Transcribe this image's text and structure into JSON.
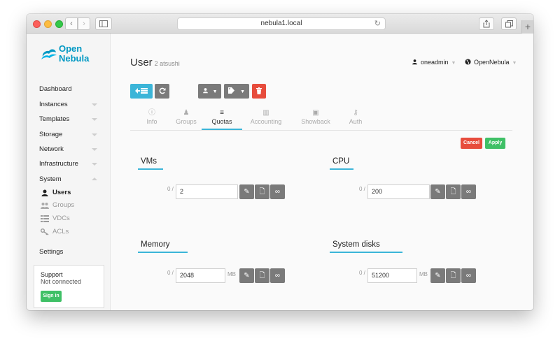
{
  "browser": {
    "url": "nebula1.local",
    "reload_glyph": "↻",
    "back_glyph": "‹",
    "forward_glyph": "›",
    "newtab_glyph": "+"
  },
  "logo": {
    "line1": "Open",
    "line2": "Nebula"
  },
  "sidebar": {
    "items": [
      {
        "label": "Dashboard"
      },
      {
        "label": "Instances"
      },
      {
        "label": "Templates"
      },
      {
        "label": "Storage"
      },
      {
        "label": "Network"
      },
      {
        "label": "Infrastructure"
      },
      {
        "label": "System"
      }
    ],
    "system_children": [
      {
        "label": "Users",
        "icon": "user-icon"
      },
      {
        "label": "Groups",
        "icon": "users-icon"
      },
      {
        "label": "VDCs",
        "icon": "list-icon"
      },
      {
        "label": "ACLs",
        "icon": "key-icon"
      }
    ],
    "settings": "Settings",
    "support": {
      "title": "Support",
      "status": "Not connected",
      "signin": "Sign in"
    }
  },
  "header": {
    "title": "User",
    "subtitle": "2 atsushi",
    "user": "oneadmin",
    "zone": "OpenNebula"
  },
  "tabs": [
    {
      "label": "Info",
      "icon": "info-icon",
      "glyph": "ⓘ"
    },
    {
      "label": "Groups",
      "icon": "users-icon",
      "glyph": "♟"
    },
    {
      "label": "Quotas",
      "icon": "align-icon",
      "glyph": "≡"
    },
    {
      "label": "Accounting",
      "icon": "bar-chart-icon",
      "glyph": "▥"
    },
    {
      "label": "Showback",
      "icon": "money-icon",
      "glyph": "▣"
    },
    {
      "label": "Auth",
      "icon": "key-icon",
      "glyph": "⚷"
    }
  ],
  "actions": {
    "cancel": "Cancel",
    "apply": "Apply"
  },
  "quotas": [
    {
      "title": "VMs",
      "used": "0 /",
      "value": "2",
      "unit": ""
    },
    {
      "title": "CPU",
      "used": "0 /",
      "value": "200",
      "unit": ""
    },
    {
      "title": "Memory",
      "used": "0 /",
      "value": "2048",
      "unit": "MB"
    },
    {
      "title": "System disks",
      "used": "0 /",
      "value": "51200",
      "unit": "MB"
    }
  ],
  "quota_button_glyphs": {
    "edit": "✎",
    "default": "🗋",
    "unlimited": "∞"
  },
  "colors": {
    "accent": "#3bb5d8",
    "danger": "#e74c3c",
    "success": "#3fc066",
    "neutral": "#7a7a7a"
  }
}
